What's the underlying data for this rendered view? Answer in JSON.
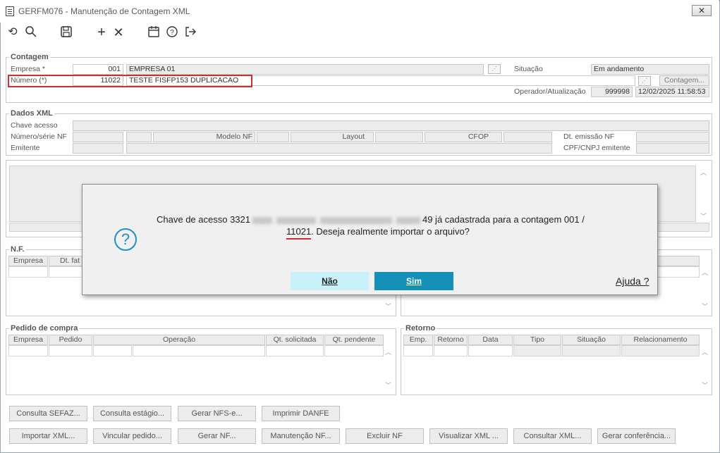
{
  "window": {
    "title": "GERFM076 - Manutenção de Contagem XML",
    "close_label": "✕"
  },
  "toolbar": {
    "undo_icon": "undo-icon",
    "search_icon": "search-icon",
    "save_icon": "save-icon",
    "add_icon": "plus-icon",
    "delete_icon": "x-icon",
    "calendar_icon": "calendar-icon",
    "help_icon": "help-icon",
    "exit_icon": "exit-icon"
  },
  "contagem": {
    "title": "Contagem",
    "empresa_label": "Empresa *",
    "empresa_code": "001",
    "empresa_name": "EMPRESA 01",
    "numero_label": "Número (*)",
    "numero_value": "11022",
    "numero_desc": "TESTE FISFP153 DUPLICACAO",
    "situacao_label": "Situação",
    "situacao_value": "Em andamento",
    "contagem_button": "Contagem...",
    "operador_label": "Operador/Atualização",
    "operador_value": "999998",
    "atualizacao_value": "12/02/2025 11:58:53"
  },
  "dados_xml": {
    "title": "Dados XML",
    "chave_label": "Chave acesso",
    "numero_serie_label": "Número/série NF",
    "emitente_label": "Emitente",
    "modelo_label": "Modelo NF",
    "layout_label": "Layout",
    "cfop_label": "CFOP",
    "dt_emissao_label": "Dt. emissão NF",
    "cpf_cnpj_label": "CPF/CNPJ emitente"
  },
  "nf": {
    "title": "N.F.",
    "columns": [
      "Empresa",
      "Dt. fat"
    ]
  },
  "pedido": {
    "title": "Pedido de compra",
    "columns": [
      "Empresa",
      "Pedido",
      "Operação",
      "Qt. solicitada",
      "Qt. pendente"
    ]
  },
  "retorno": {
    "title": "Retorno",
    "columns": [
      "Emp.",
      "Retorno",
      "Data",
      "Tipo",
      "Situação",
      "Relacionamento"
    ]
  },
  "buttons_row1": [
    "Consulta SEFAZ...",
    "Consulta estágio...",
    "Gerar NFS-e...",
    "Imprimir DANFE"
  ],
  "buttons_row2": [
    "Importar XML...",
    "Vincular pedido...",
    "Gerar NF...",
    "Manutenção NF...",
    "Excluir NF",
    "Visualizar XML ...",
    "Consultar XML...",
    "Gerar conferência..."
  ],
  "dialog": {
    "icon": "question-icon",
    "line1_prefix": "Chave de acesso 3321",
    "line1_suffix": "49 já cadastrada para a contagem 001 /",
    "line2_number": "11021",
    "line2_rest": ". Deseja realmente importar o arquivo?",
    "no_label": "Não",
    "yes_label": "Sim",
    "help_label": "Ajuda ?",
    "colors": {
      "no_bg": "#c9f1f9",
      "yes_bg": "#1590b8",
      "yes_text": "#ffffff",
      "icon": "#1e8fc7"
    }
  }
}
